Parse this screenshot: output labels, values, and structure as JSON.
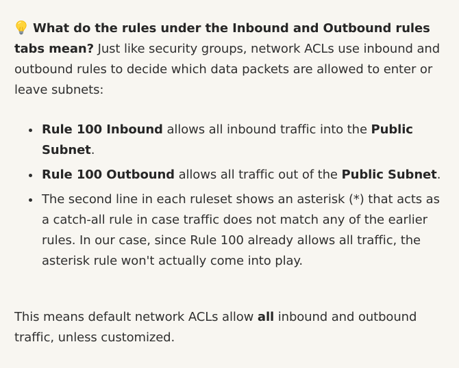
{
  "intro": {
    "icon": "lightbulb-icon",
    "question": "What do the rules under the Inbound and Outbound rules tabs mean?",
    "text": " Just like security groups, network ACLs use inbound and outbound rules to decide which data packets are allowed to enter or leave subnets:"
  },
  "bullets": [
    {
      "lead_bold": "Rule 100 Inbound",
      "middle": " allows all inbound traffic into the ",
      "tail_bold": "Public Subnet",
      "end": "."
    },
    {
      "lead_bold": "Rule 100 Outbound",
      "middle": " allows all traffic out of the ",
      "tail_bold": "Public Subnet",
      "end": "."
    },
    {
      "text": "The second line in each ruleset shows an asterisk (*) that acts as a catch-all rule in case traffic does not match any of the earlier rules. In our case, since Rule 100 already allows all traffic, the asterisk rule won't actually come into play."
    }
  ],
  "outro": {
    "before": "This means default network ACLs allow ",
    "bold": "all",
    "after": " inbound and outbound traffic, unless customized."
  }
}
